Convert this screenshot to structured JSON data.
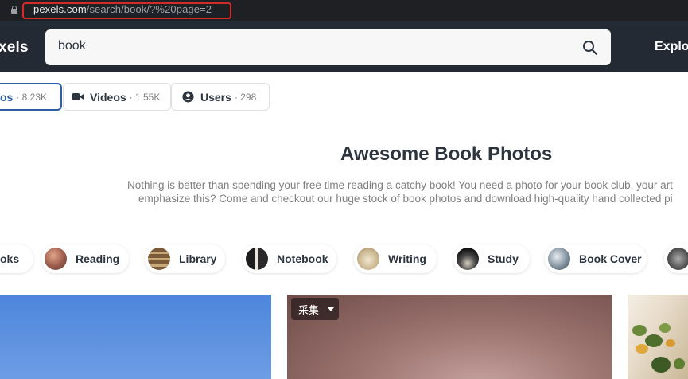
{
  "browser": {
    "url_host": "pexels.com",
    "url_path": "/search/book/?%20page=2"
  },
  "header": {
    "logo": "xels",
    "search_value": "book",
    "explore_label": "Explore"
  },
  "tabs": [
    {
      "label": "os",
      "count": "· 8.23K",
      "active": true
    },
    {
      "label": "Videos",
      "count": "· 1.55K",
      "icon": "video-camera-icon"
    },
    {
      "label": "Users",
      "count": "· 298",
      "icon": "user-circle-icon"
    }
  ],
  "content": {
    "headline": "Awesome Book Photos",
    "description_line1": "Nothing is better than spending your free time reading a catchy book! You need a photo for your book club, your art",
    "description_line2": "emphasize this? Come and checkout our huge stock of book photos and download high-quality hand collected pi"
  },
  "categories": [
    {
      "label": "oks"
    },
    {
      "label": "Reading"
    },
    {
      "label": "Library"
    },
    {
      "label": "Notebook"
    },
    {
      "label": "Writing"
    },
    {
      "label": "Study"
    },
    {
      "label": "Book Cover"
    }
  ],
  "photos": {
    "collect_label": "采集"
  },
  "colors": {
    "header_bg": "#232a34",
    "accent": "#2e5ea8",
    "highlight_box": "#d42a2a"
  }
}
